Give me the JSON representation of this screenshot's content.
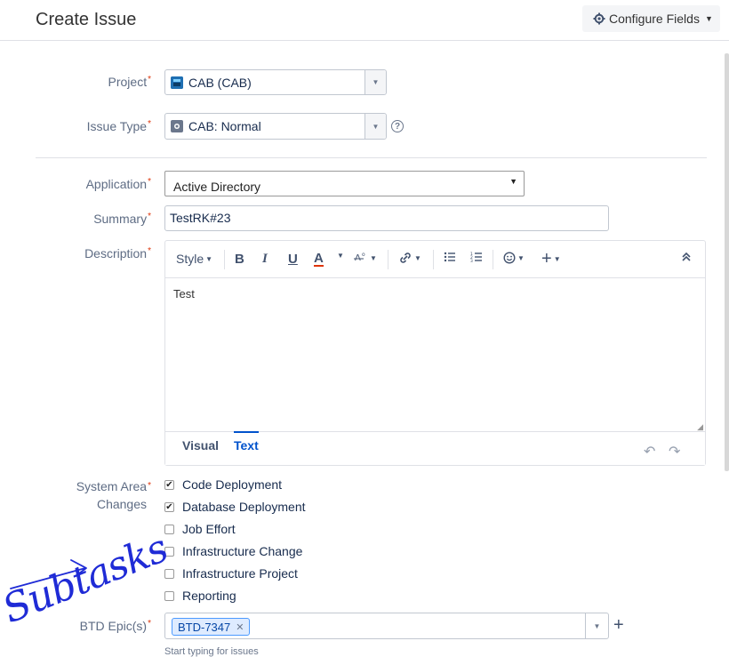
{
  "dialog": {
    "title": "Create Issue",
    "configure_fields_label": "Configure Fields"
  },
  "project": {
    "label": "Project",
    "value": "CAB (CAB)",
    "icon": "project-icon",
    "icon_color": "#2684ff"
  },
  "issue_type": {
    "label": "Issue Type",
    "value": "CAB: Normal",
    "icon": "issue-type-icon"
  },
  "application": {
    "label": "Application",
    "value": "Active Directory"
  },
  "summary": {
    "label": "Summary",
    "value": "TestRK#23"
  },
  "description": {
    "label": "Description",
    "toolbar": {
      "style_label": "Style",
      "bold": "B",
      "italic": "I",
      "underline": "U",
      "text_color": "A"
    },
    "content": "Test",
    "tabs": {
      "visual": "Visual",
      "text": "Text"
    },
    "active_tab": "Text"
  },
  "system_area_changes": {
    "label_line1": "System Area",
    "label_line2": "Changes",
    "options": [
      {
        "label": "Code Deployment",
        "checked": true
      },
      {
        "label": "Database Deployment",
        "checked": true
      },
      {
        "label": "Job Effort",
        "checked": false
      },
      {
        "label": "Infrastructure Change",
        "checked": false
      },
      {
        "label": "Infrastructure Project",
        "checked": false
      },
      {
        "label": "Reporting",
        "checked": false
      }
    ]
  },
  "btd_epics": {
    "label": "BTD Epic(s)",
    "tags": [
      "BTD-7347"
    ],
    "hint": "Start typing for issues"
  },
  "annotation": {
    "text": "Subtasks",
    "color": "#1f2bd6"
  },
  "colors": {
    "required": "#de350b",
    "link": "#0052cc"
  }
}
